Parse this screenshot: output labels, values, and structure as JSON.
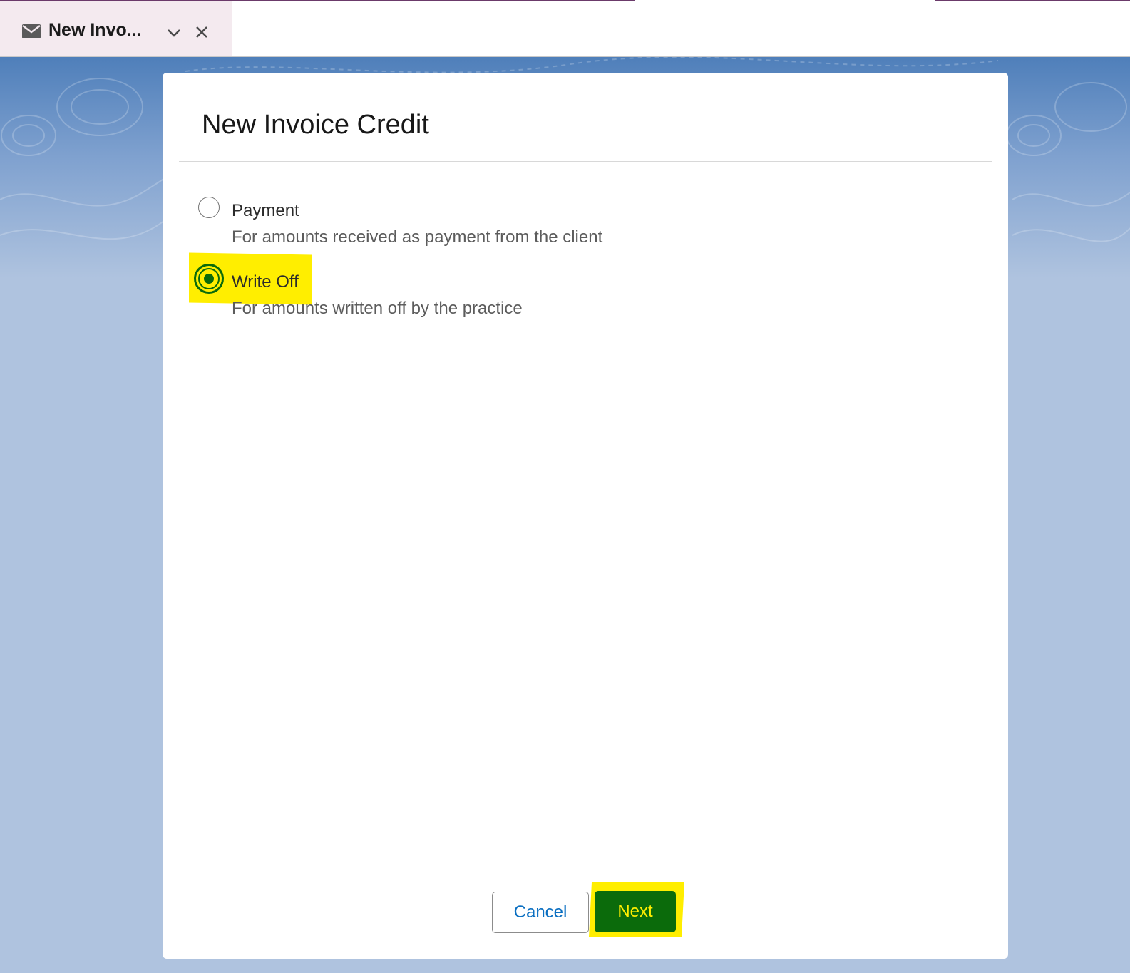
{
  "tabbar": {
    "tab": {
      "icon": "envelope-icon",
      "label": "New Invo...",
      "menu_icon": "chevron-down-icon",
      "close_icon": "close-icon"
    }
  },
  "modal": {
    "title": "New Invoice Credit",
    "options": [
      {
        "label": "Payment",
        "description": "For amounts received as payment from the client",
        "selected": false
      },
      {
        "label": "Write Off",
        "description": "For amounts written off by the practice",
        "selected": true
      }
    ],
    "footer": {
      "cancel_label": "Cancel",
      "next_label": "Next"
    }
  },
  "colors": {
    "highlight": "#ffee00",
    "selected_green": "#0b6b0b",
    "link_blue": "#0b6fc1",
    "background": "#afc3df",
    "tab_background": "#f4eaef"
  }
}
